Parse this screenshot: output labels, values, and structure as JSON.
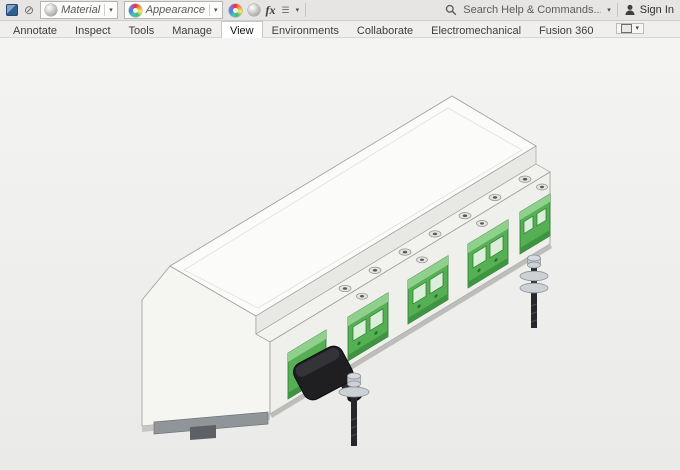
{
  "toolbar": {
    "material_value": "Material",
    "appearance_value": "Appearance",
    "fx_label": "fx",
    "search_placeholder": "Search Help & Commands...",
    "sign_in_label": "Sign In"
  },
  "ribbon": {
    "tabs": [
      "Annotate",
      "Inspect",
      "Tools",
      "Manage",
      "View",
      "Environments",
      "Collaborate",
      "Electromechanical",
      "Fusion 360"
    ],
    "active_tab": "View"
  },
  "icons": {
    "caret_glyph": "▾",
    "no_material_glyph": "⊘",
    "list_glyph": "☰"
  },
  "viewport": {
    "model": "din-rail-terminal-module"
  },
  "colors": {
    "toolbar_bg": "#e7e5e3",
    "tabrow_bg": "#f1efed",
    "tab_active_bg": "#ffffff",
    "viewport_top": "#f4f4f3",
    "viewport_bottom": "#eaeae8",
    "body_top": "#fbfbf9",
    "body_step": "#e8e8e5",
    "body_band": "#f2f2ef",
    "body_front": "#efefec",
    "body_side": "#f5f5f2",
    "edge": "#9c9c9a",
    "hole_fill": "#e3e3e0",
    "terminal_green": "#55b054",
    "terminal_green_light": "#8fd18c",
    "terminal_green_dark": "#3f9442",
    "terminal_slot": "#d9efd7",
    "terminal_outline": "#2a7430",
    "connector_black": "#1f1f22",
    "connector_top": "#3b3b40",
    "metal": "#ccd1d5",
    "metal_dark": "#8d9296",
    "shaft": "#27272b",
    "din_gray": "#8f9599",
    "din_dark": "#5d6165"
  }
}
